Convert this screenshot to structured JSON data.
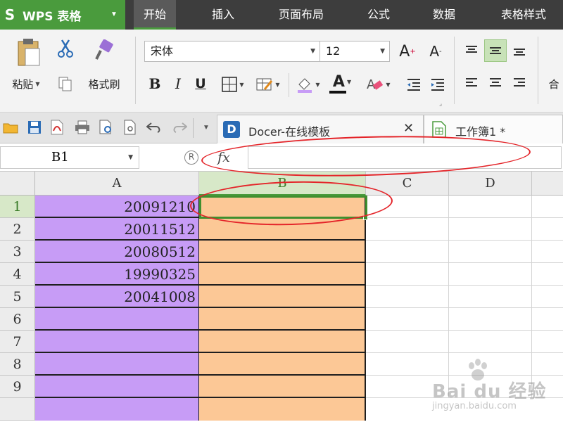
{
  "app": {
    "logo": "S",
    "title": "WPS 表格"
  },
  "menu": {
    "tabs": [
      "开始",
      "插入",
      "页面布局",
      "公式",
      "数据",
      "表格样式"
    ]
  },
  "ribbon": {
    "paste_label": "粘贴",
    "cut_label": "剪切",
    "format_painter_label": "格式刷",
    "copy_label": "复制",
    "font_name": "宋体",
    "font_size": "12",
    "grow_font": "A",
    "shrink_font": "A",
    "bold": "B",
    "italic": "I",
    "underline": "U",
    "font_color_glyph": "A",
    "merge_label": "合"
  },
  "doc_tabs": [
    {
      "title": "Docer-在线模板"
    },
    {
      "title": "工作簿1 *"
    }
  ],
  "formula_bar": {
    "cell_ref": "B1",
    "fx": "fx",
    "formula_value": ""
  },
  "sheet": {
    "columns": [
      "A",
      "B",
      "C",
      "D"
    ],
    "rows": [
      {
        "num": "1",
        "a": "20091210",
        "b": ""
      },
      {
        "num": "2",
        "a": "20011512",
        "b": ""
      },
      {
        "num": "3",
        "a": "20080512",
        "b": ""
      },
      {
        "num": "4",
        "a": "19990325",
        "b": ""
      },
      {
        "num": "5",
        "a": "20041008",
        "b": ""
      },
      {
        "num": "6",
        "a": "",
        "b": ""
      },
      {
        "num": "7",
        "a": "",
        "b": ""
      },
      {
        "num": "8",
        "a": "",
        "b": ""
      },
      {
        "num": "9",
        "a": "",
        "b": ""
      }
    ],
    "selected_cell": "B1"
  },
  "watermark": {
    "brand": "Bai du 经验",
    "url": "jingyan.baidu.com"
  },
  "colors": {
    "accent": "#4a9b3d",
    "column_a_fill": "#c79cf6",
    "column_b_fill": "#fcc896",
    "annotation": "#e4252a"
  }
}
